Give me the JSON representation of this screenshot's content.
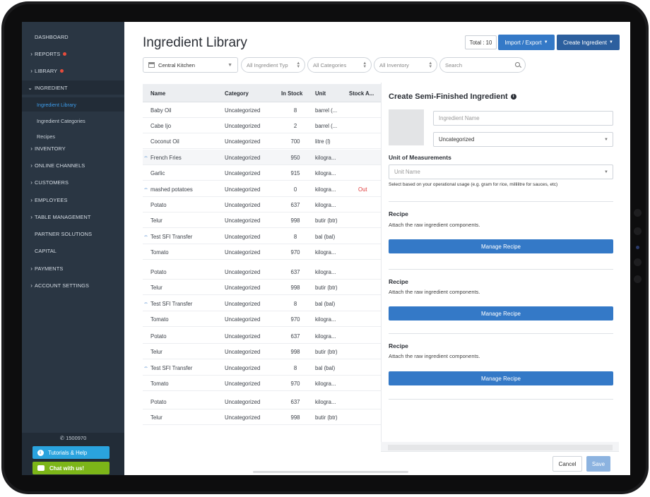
{
  "sidebar": {
    "items": [
      {
        "label": "DASHBOARD"
      },
      {
        "label": "REPORTS"
      },
      {
        "label": "LIBRARY"
      },
      {
        "label": "INGREDIENT"
      },
      {
        "label": "INVENTORY"
      },
      {
        "label": "ONLINE CHANNELS"
      },
      {
        "label": "CUSTOMERS"
      },
      {
        "label": "EMPLOYEES"
      },
      {
        "label": "TABLE MANAGEMENT"
      },
      {
        "label": "PARTNER SOLUTIONS"
      },
      {
        "label": "CAPITAL"
      },
      {
        "label": "PAYMENTS"
      },
      {
        "label": "ACCOUNT SETTINGS"
      }
    ],
    "sub_items": [
      {
        "label": "Ingredient Library"
      },
      {
        "label": "Ingredient Categories"
      },
      {
        "label": "Recipes"
      }
    ],
    "phone": "1500970",
    "help_label": "Tutorials & Help",
    "chat_label": "Chat with us!"
  },
  "header": {
    "title": "Ingredient Library",
    "total": "Total : 10",
    "import_export": "Import / Export",
    "create": "Create Ingredient"
  },
  "filters": {
    "kitchen": "Central Kitchen",
    "type": "All Ingredient Typ",
    "categories": "All Categories",
    "inventory": "All Inventory",
    "search_placeholder": "Search"
  },
  "table": {
    "headers": [
      "Name",
      "Category",
      "In Stock",
      "Unit",
      "Stock A..."
    ],
    "rows": [
      {
        "name": "Baby Oil",
        "category": "Uncategorized",
        "stock": "8",
        "unit": "barrel (...",
        "alert": ""
      },
      {
        "name": "Cabe Ijo",
        "category": "Uncategorized",
        "stock": "2",
        "unit": "barrel (...",
        "alert": ""
      },
      {
        "name": "Coconut Oil",
        "category": "Uncategorized",
        "stock": "700",
        "unit": "litre (l)",
        "alert": ""
      },
      {
        "name": "French Fries",
        "category": "Uncategorized",
        "stock": "950",
        "unit": "kilogra...",
        "alert": ""
      },
      {
        "name": "Garlic",
        "category": "Uncategorized",
        "stock": "915",
        "unit": "kilogra...",
        "alert": ""
      },
      {
        "name": "mashed potatoes",
        "category": "Uncategorized",
        "stock": "0",
        "unit": "kilogra...",
        "alert": "Out"
      },
      {
        "name": "Potato",
        "category": "Uncategorized",
        "stock": "637",
        "unit": "kilogra...",
        "alert": ""
      },
      {
        "name": "Telur",
        "category": "Uncategorized",
        "stock": "998",
        "unit": "butir (btr)",
        "alert": ""
      },
      {
        "name": "Test SFI Transfer",
        "category": "Uncategorized",
        "stock": "8",
        "unit": "bal (bal)",
        "alert": ""
      },
      {
        "name": "Tomato",
        "category": "Uncategorized",
        "stock": "970",
        "unit": "kilogra...",
        "alert": ""
      },
      {
        "name": "Potato",
        "category": "Uncategorized",
        "stock": "637",
        "unit": "kilogra...",
        "alert": ""
      },
      {
        "name": "Telur",
        "category": "Uncategorized",
        "stock": "998",
        "unit": "butir (btr)",
        "alert": ""
      },
      {
        "name": "Test SFI Transfer",
        "category": "Uncategorized",
        "stock": "8",
        "unit": "bal (bal)",
        "alert": ""
      },
      {
        "name": "Tomato",
        "category": "Uncategorized",
        "stock": "970",
        "unit": "kilogra...",
        "alert": ""
      },
      {
        "name": "Potato",
        "category": "Uncategorized",
        "stock": "637",
        "unit": "kilogra...",
        "alert": ""
      },
      {
        "name": "Telur",
        "category": "Uncategorized",
        "stock": "998",
        "unit": "butir (btr)",
        "alert": ""
      },
      {
        "name": "Test SFI Transfer",
        "category": "Uncategorized",
        "stock": "8",
        "unit": "bal (bal)",
        "alert": ""
      },
      {
        "name": "Tomato",
        "category": "Uncategorized",
        "stock": "970",
        "unit": "kilogra...",
        "alert": ""
      },
      {
        "name": "Potato",
        "category": "Uncategorized",
        "stock": "637",
        "unit": "kilogra...",
        "alert": ""
      },
      {
        "name": "Telur",
        "category": "Uncategorized",
        "stock": "998",
        "unit": "butir (btr)",
        "alert": ""
      }
    ]
  },
  "panel": {
    "title": "Create Semi-Finished Ingredient",
    "name_placeholder": "Ingredient Name",
    "category_value": "Uncategorized",
    "uom_label": "Unit of Measurements",
    "uom_placeholder": "Unit Name",
    "uom_help": "Select based on your operational usage (e.g. gram for rice, millilitre for sauces, etc)",
    "recipes": [
      {
        "title": "Recipe",
        "subtitle": "Attach the raw ingredient components.",
        "button": "Manage Recipe"
      },
      {
        "title": "Recipe",
        "subtitle": "Attach the raw ingredient components.",
        "button": "Manage Recipe"
      },
      {
        "title": "Recipe",
        "subtitle": "Attach the raw ingredient components.",
        "button": "Manage Recipe"
      }
    ],
    "cancel": "Cancel",
    "save": "Save"
  },
  "colors": {
    "sidebar_bg": "#2a3643",
    "accent_blue": "#3479c7",
    "create_btn": "#2c5f9e",
    "out_red": "#e03c3c",
    "chat_green": "#7cb518",
    "help_blue": "#2aa3de"
  }
}
